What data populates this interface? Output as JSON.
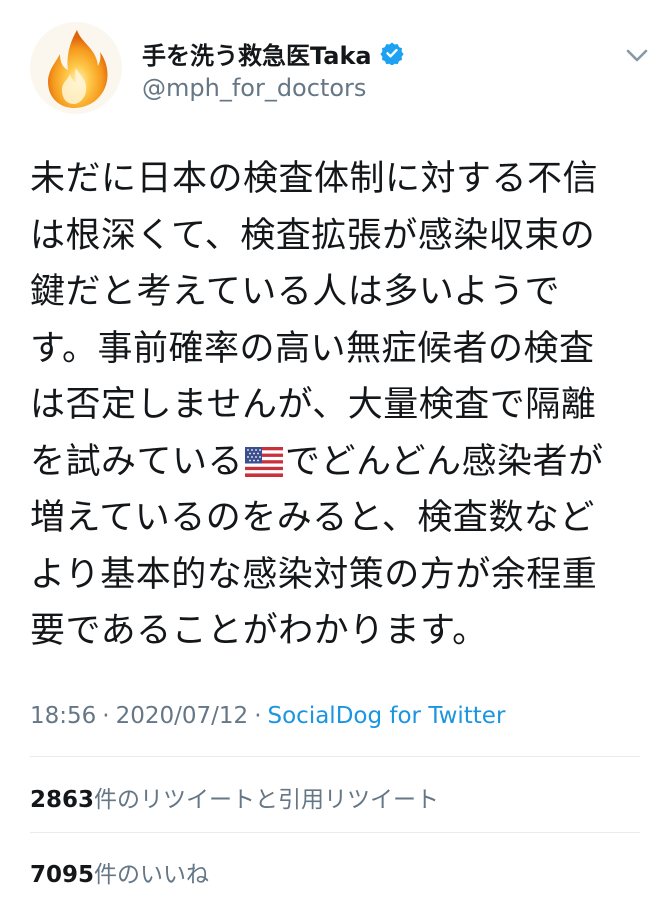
{
  "user": {
    "display_name": "手を洗う救急医Taka",
    "handle": "@mph_for_doctors",
    "verified": true
  },
  "icons": {
    "avatar": "flame-avatar",
    "verified": "verified-badge-icon",
    "menu": "chevron-down-icon",
    "flag": "us-flag-emoji"
  },
  "tweet": {
    "lines": [
      "未だに日本の検査体制に対する不信",
      "は根深くて、検査拡張が感染収束の",
      "鍵だと考えている人は多いようで",
      "す。事前確率の高い無症候者の検査",
      "は否定しませんが、大量検査で隔離",
      "を試みている",
      "でどんどん感染者が",
      "増えているのをみると、検査数など",
      "より基本的な感染対策の方が余程重",
      "要であることがわかります。"
    ]
  },
  "meta": {
    "time": "18:56",
    "date": "2020/07/12",
    "separator": "·",
    "source": "SocialDog for Twitter"
  },
  "stats": {
    "retweets_count": "2863",
    "retweets_label": "件のリツイートと引用リツイート",
    "likes_count": "7095",
    "likes_label": "件のいいね"
  },
  "colors": {
    "text": "#14171a",
    "secondary": "#657786",
    "link": "#1b95e0",
    "verified": "#1da1f2",
    "divider": "#e6ecf0"
  }
}
